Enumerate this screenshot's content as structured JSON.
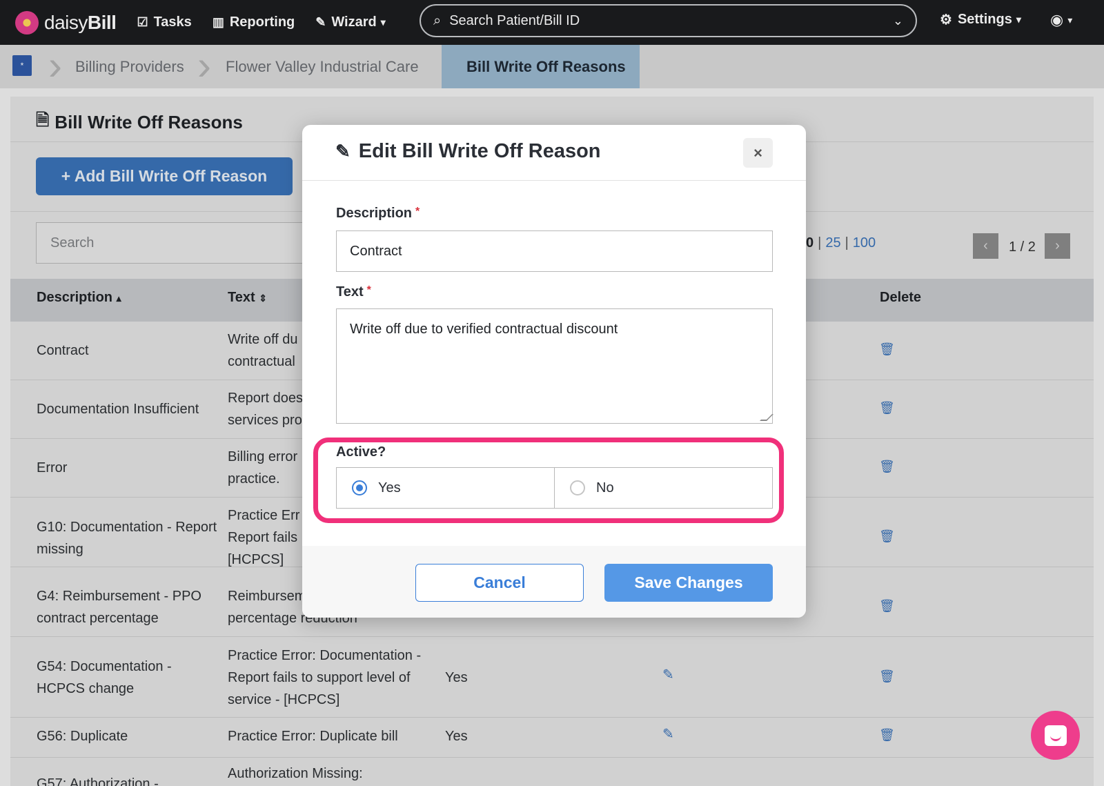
{
  "nav": {
    "brand_light": "daisy",
    "brand_bold": "Bill",
    "tasks": "Tasks",
    "reporting": "Reporting",
    "wizard": "Wizard",
    "search_placeholder": "Search Patient/Bill ID",
    "settings": "Settings"
  },
  "breadcrumb": {
    "home_icon": "*",
    "items": [
      "Billing Providers",
      "Flower Valley Industrial Care",
      "Bill Write Off Reasons"
    ]
  },
  "page": {
    "title": "Bill Write Off Reasons",
    "add_button": "+ Add Bill Write Off Reason",
    "search_placeholder": "Search",
    "page_sizes": {
      "current": "0",
      "opt1": "25",
      "opt2": "100"
    },
    "page_label": "1 / 2"
  },
  "table": {
    "headers": {
      "description": "Description",
      "text": "Text",
      "delete": "Delete"
    },
    "rows": [
      {
        "description": "Contract",
        "text1": "Write off du",
        "text2": "contractual",
        "text3": "",
        "active": ""
      },
      {
        "description": "Documentation Insufficient",
        "text1": "Report does",
        "text2": "services pro",
        "text3": "",
        "active": ""
      },
      {
        "description": "Error",
        "text1": "Billing error",
        "text2": "practice.",
        "text3": "",
        "active": ""
      },
      {
        "description": "G10: Documentation - Report missing",
        "text1": "Practice Err",
        "text2": "Report fails",
        "text3": "[HCPCS]",
        "active": ""
      },
      {
        "description": "G4: Reimbursement - PPO contract percentage",
        "text1": "Reimburseme",
        "text2": "percentage reduction",
        "text3": "",
        "active": ""
      },
      {
        "description": "G54: Documentation - HCPCS change",
        "text1": "Practice Error: Documentation -",
        "text2": "Report fails to support level of",
        "text3": "service - [HCPCS]",
        "active": "Yes"
      },
      {
        "description": "G56: Duplicate",
        "text1": "Practice Error: Duplicate bill",
        "text2": "",
        "text3": "",
        "active": "Yes"
      },
      {
        "description": "G57: Authorization -",
        "text1": "Authorization Missing:",
        "text2": "",
        "text3": "",
        "active": ""
      }
    ]
  },
  "modal": {
    "title": "Edit Bill Write Off Reason",
    "close": "×",
    "description_label": "Description",
    "description_value": "Contract",
    "text_label": "Text",
    "text_value": "Write off due to verified contractual discount",
    "required_mark": "*",
    "active_label": "Active?",
    "active_options": [
      "Yes",
      "No"
    ],
    "active_selected": "Yes",
    "cancel": "Cancel",
    "save": "Save Changes"
  },
  "colors": {
    "highlight": "#f0307a",
    "primary": "#3a7ed8",
    "nav_bg": "#1c1d1f"
  }
}
